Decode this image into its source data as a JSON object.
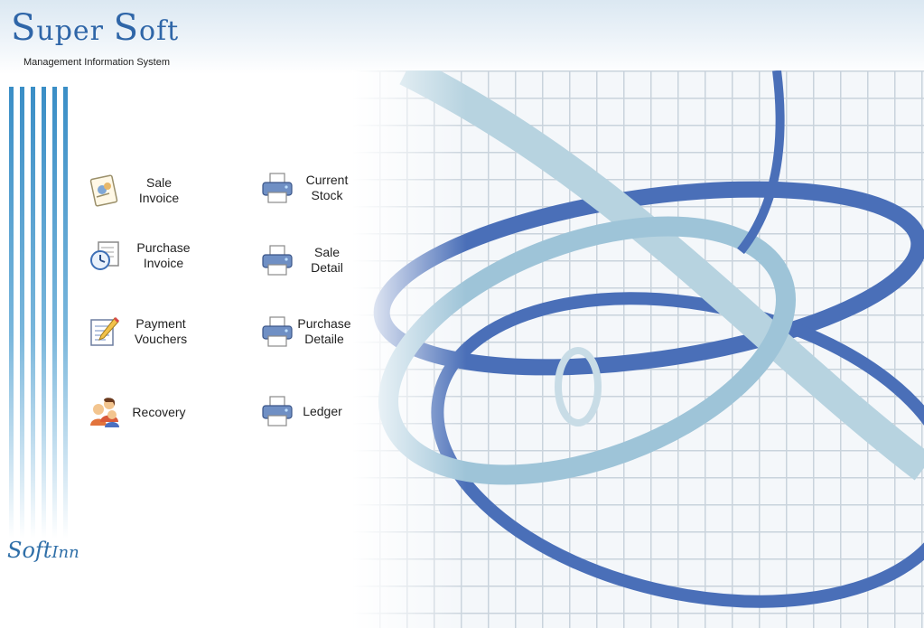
{
  "header": {
    "brand_first": "S",
    "brand_rest_1": "uper ",
    "brand_second": "S",
    "brand_rest_2": "oft",
    "tagline": "Management Information System"
  },
  "menu": {
    "sale_invoice": {
      "label": "Sale\nInvoice",
      "icon": "invoice-icon"
    },
    "purchase_invoice": {
      "label": "Purchase\nInvoice",
      "icon": "clock-document-icon"
    },
    "payment_vouchers": {
      "label": "Payment\nVouchers",
      "icon": "notepad-pencil-icon"
    },
    "recovery": {
      "label": "Recovery",
      "icon": "people-icon"
    },
    "current_stock": {
      "label": "Current\nStock",
      "icon": "printer-icon"
    },
    "sale_detail": {
      "label": "Sale\nDetail",
      "icon": "printer-icon"
    },
    "purchase_detaile": {
      "label": "Purchase\nDetaile",
      "icon": "printer-icon"
    },
    "ledger": {
      "label": "Ledger",
      "icon": "printer-icon"
    }
  },
  "footer_logo": {
    "part1": "Soft",
    "part2": "Inn"
  },
  "colors": {
    "brand_blue": "#2f66a8",
    "stripe_blue": "#3a8ec6",
    "art_dark": "#4a6fb8",
    "art_light": "#9ec4d8"
  }
}
